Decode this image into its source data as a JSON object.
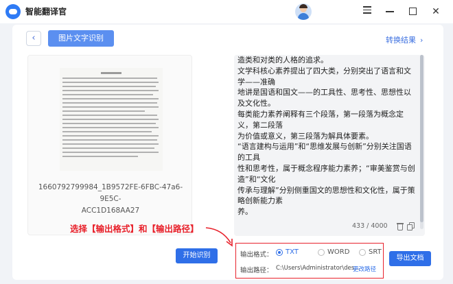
{
  "app": {
    "title": "智能翻译官"
  },
  "header": {
    "back_icon": "chevron-left-icon",
    "tab_label": "图片文字识别",
    "convert_link": "转换结果",
    "convert_chevron": "›"
  },
  "left_panel": {
    "filename_line1": "1660792799984_1B9572FE-6FBC-47a6-9E5C-",
    "filename_line2": "ACC1D168AA27"
  },
  "ocr": {
    "text": "造类和对类的人格的追求。\n文学科核心素养提出了四大类，分别突出了语言和文学——准确\n地讲是国语和国文——的工具性、思考性、思想性以及文化性。\n每类能力素养阐释有三个段落，第一段落为概念定义，第二段落\n为价值或意义，第三段落为解具体要素。\n“语言建构与运用”和“思维发展与创新”分别关注国语的工具\n性和思考性，属于概念程序能力素养；“审美鉴赏与创造”和“文化\n传承与理解”分别侧重国文的思想性和文化性，属于策略创新能力素\n养。",
    "char_count": "433 / 4000"
  },
  "annotation": {
    "text": "选择【输出格式】和【输出路径】"
  },
  "bottom": {
    "start_button": "开始识别",
    "format_label": "输出格式：",
    "formats": [
      "TXT",
      "WORD",
      "SRT"
    ],
    "selected_format": "TXT",
    "path_label": "输出路径：",
    "path_value": "C:\\Users\\Administrator\\des...",
    "change_path": "更改路径",
    "export_button": "导出文档"
  },
  "colors": {
    "accent": "#2f6fe8",
    "tab": "#5b8ff0",
    "annotation_red": "#e8202a",
    "card_bg": "#ffffff",
    "app_bg": "#f1f3f7"
  }
}
